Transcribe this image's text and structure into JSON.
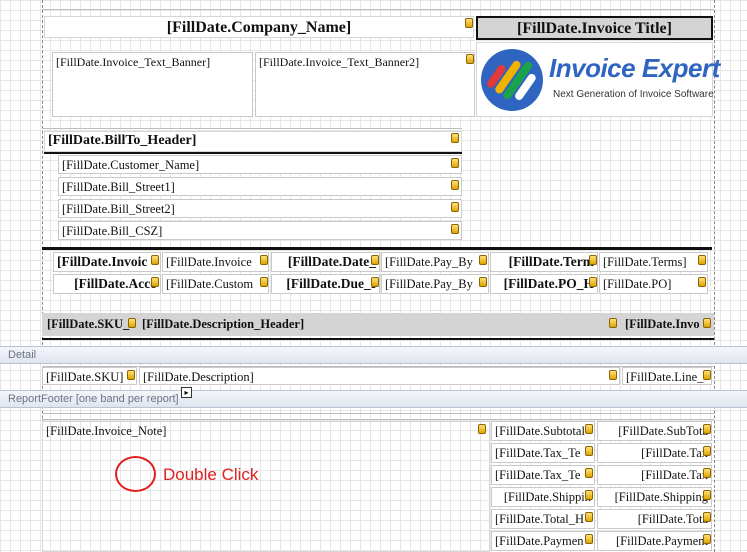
{
  "header": {
    "company_name": "[FillDate.Company_Name]",
    "invoice_title": "[FillDate.Invoice  Title]",
    "text_banner": "[FillDate.Invoice_Text_Banner]",
    "text_banner2": "[FillDate.Invoice_Text_Banner2]"
  },
  "logo": {
    "brand": "Invoice Expert",
    "tagline": "Next Generation of Invoice Software",
    "colors": [
      "#2f64c0",
      "#1aa34a",
      "#f0b400",
      "#e03a3a"
    ]
  },
  "billto": {
    "header": "[FillDate.BillTo_Header]",
    "lines": [
      "[FillDate.Customer_Name]",
      "[FillDate.Bill_Street1]",
      "[FillDate.Bill_Street2]",
      "[FillDate.Bill_CSZ]"
    ]
  },
  "info": {
    "row1": [
      "[FillDate.Invoic",
      "[FillDate.Invoice",
      "[FillDate.Date_",
      "[FillDate.Pay_By",
      "[FillDate.Term",
      "[FillDate.Terms]"
    ],
    "row2": [
      "[FillDate.Acco",
      "[FillDate.Custom",
      "[FillDate.Due_I",
      "[FillDate.Pay_By",
      "[FillDate.PO_H",
      "[FillDate.PO]"
    ]
  },
  "columns": {
    "sku_header": "[FillDate.SKU_",
    "desc_header": "[FillDate.Description_Header]",
    "invo_header": "[FillDate.Invo"
  },
  "bands": {
    "detail": "Detail",
    "report_footer": "ReportFooter [one band per report]"
  },
  "detail": {
    "sku": "[FillDate.SKU]",
    "description": "[FillDate.Description]",
    "line": "[FillDate.Line_"
  },
  "footer": {
    "invoice_note": "[FillDate.Invoice_Note]",
    "annotation": "Double Click",
    "totals_labels": [
      "[FillDate.Subtotal",
      "[FillDate.Tax_Te",
      "[FillDate.Tax_Te",
      "[FillDate.Shippin",
      "[FillDate.Total_H",
      "[FillDate.Paymen"
    ],
    "totals_values": [
      "[FillDate.SubTota",
      "[FillDate.Tax",
      "[FillDate.Tax",
      "[FillDate.Shipping",
      "[FillDate.Tota",
      "[FillDate.Payment"
    ]
  }
}
